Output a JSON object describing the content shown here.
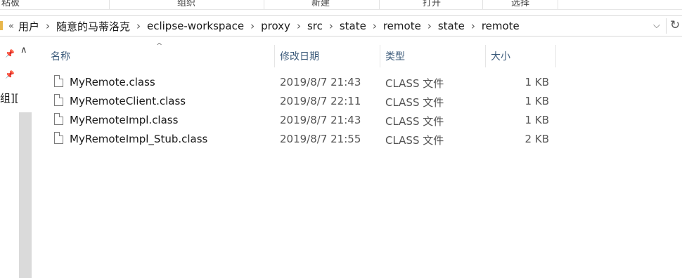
{
  "ribbon": {
    "groups": [
      "粘板",
      "组织",
      "新建",
      "打开",
      "选择"
    ]
  },
  "address": {
    "overflow": "«",
    "segments": [
      "用户",
      "随意的马蒂洛克",
      "eclipse-workspace",
      "proxy",
      "src",
      "state",
      "remote",
      "state",
      "remote"
    ],
    "dropdown_icon": "chevron-down-icon",
    "refresh_icon": "refresh-icon"
  },
  "nav": {
    "partial_text": "组]["
  },
  "columns": {
    "name": "名称",
    "date": "修改日期",
    "type": "类型",
    "size": "大小"
  },
  "files": [
    {
      "name": "MyRemote.class",
      "date": "2019/8/7 21:43",
      "type": "CLASS 文件",
      "size": "1 KB"
    },
    {
      "name": "MyRemoteClient.class",
      "date": "2019/8/7 22:11",
      "type": "CLASS 文件",
      "size": "1 KB"
    },
    {
      "name": "MyRemoteImpl.class",
      "date": "2019/8/7 21:43",
      "type": "CLASS 文件",
      "size": "1 KB"
    },
    {
      "name": "MyRemoteImpl_Stub.class",
      "date": "2019/8/7 21:55",
      "type": "CLASS 文件",
      "size": "2 KB"
    }
  ]
}
